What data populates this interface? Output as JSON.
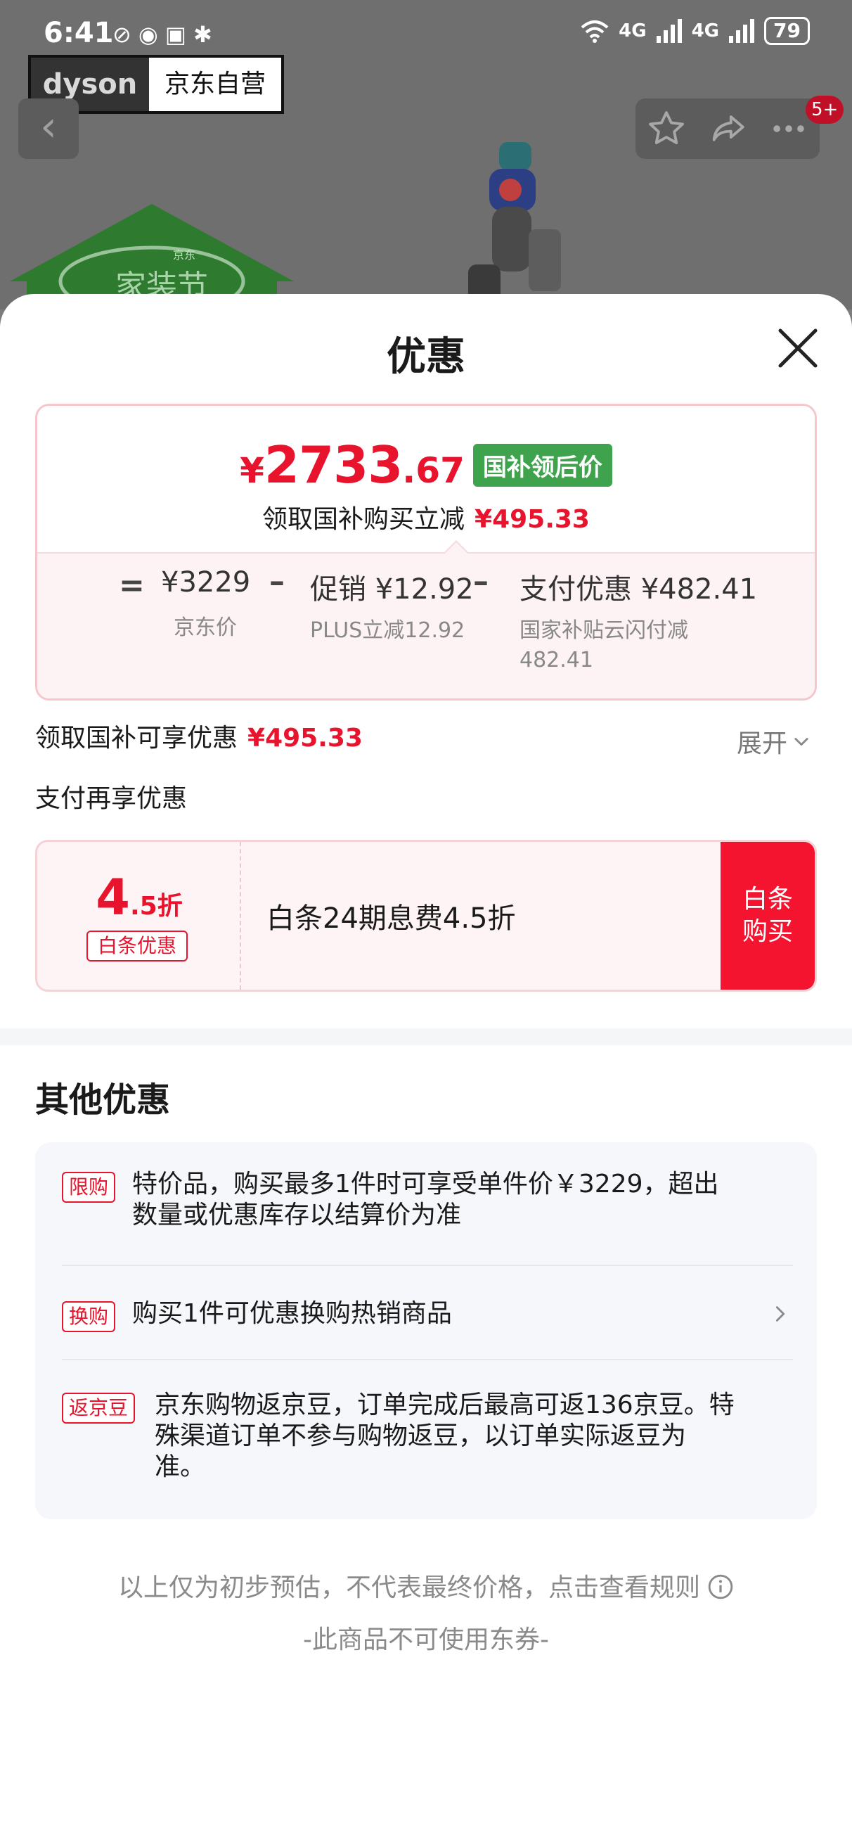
{
  "status_bar": {
    "time": "6:41",
    "left_icons": [
      "speed-icon",
      "eye-icon",
      "nfc-icon",
      "bluetooth-icon"
    ],
    "network_1": "4G",
    "network_2": "4G",
    "battery": "79"
  },
  "background_page": {
    "brand": "dyson",
    "store": "京东自营",
    "message_badge": "5+",
    "promo_label": "家装节",
    "promo_small": "京东"
  },
  "sheet": {
    "title": "优惠",
    "price_card": {
      "currency": "¥",
      "price_int": "2733",
      "price_dec": ".67",
      "price_tag": "国补领后价",
      "subtitle": "领取国补购买立减",
      "subtitle_amount": "¥495.33",
      "formula": {
        "eq": "=",
        "minus": "–",
        "base_value": "¥3229",
        "base_label": "京东价",
        "promo_prefix": "促销",
        "promo_value": "¥12.92",
        "promo_label": "PLUS立减12.92",
        "pay_prefix": "支付优惠",
        "pay_value": "¥482.41",
        "pay_label_line1": "国家补贴云闪付减",
        "pay_label_line2": "482.41"
      }
    },
    "gov_subsidy": {
      "label": "领取国补可享优惠",
      "amount": "¥495.33",
      "expand_label": "展开"
    },
    "pay_section_label": "支付再享优惠",
    "baitiao": {
      "rate_big": "4",
      "rate_small": ".5折",
      "tag": "白条优惠",
      "desc": "白条24期息费4.5折",
      "button_line1": "白条",
      "button_line2": "购买"
    },
    "other": {
      "title": "其他优惠",
      "items": [
        {
          "tag": "限购",
          "line1": "特价品，购买最多1件时可享受单件价￥3229，超出",
          "line2": "数量或优惠库存以结算价为准"
        },
        {
          "tag": "换购",
          "line1": "购买1件可优惠换购热销商品"
        },
        {
          "tag": "返京豆",
          "line1": "京东购物返京豆，订单完成后最高可返136京豆。特",
          "line2": "殊渠道订单不参与购物返豆，以订单实际返豆为",
          "line3": "准。"
        }
      ]
    },
    "disclaimer": "以上仅为初步预估，不代表最终价格，点击查看规则",
    "no_coupon": "-此商品不可使用东券-"
  },
  "colors": {
    "accent_red": "#e8132c",
    "button_red": "#f5142f",
    "tag_green": "#3fa34d",
    "card_pink": "#fef3f4"
  }
}
